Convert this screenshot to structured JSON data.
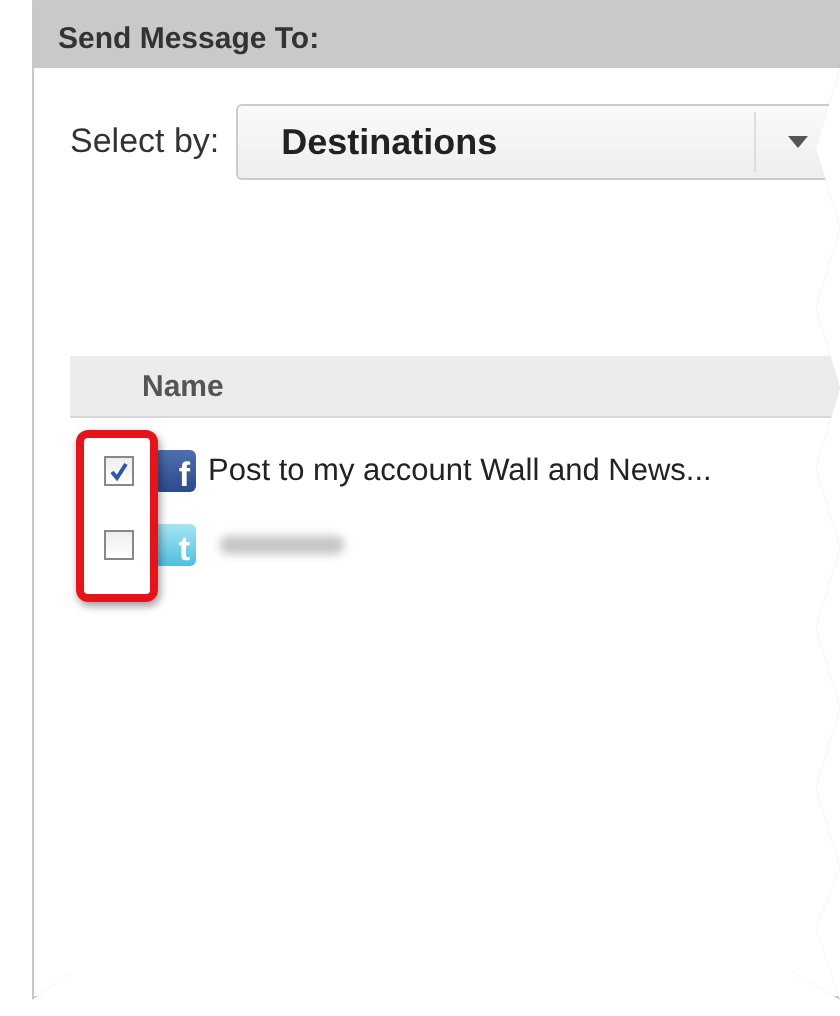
{
  "panel": {
    "title": "Send Message To:"
  },
  "select_by": {
    "label": "Select by:",
    "value": "Destinations"
  },
  "table": {
    "columns": [
      "Name"
    ],
    "rows": [
      {
        "kind": "facebook",
        "checked": true,
        "icon_glyph": "f",
        "name": "Post to my account Wall and News..."
      },
      {
        "kind": "twitter",
        "checked": false,
        "icon_glyph": "t",
        "redacted": true
      }
    ]
  },
  "annotation": {
    "kind": "highlight"
  }
}
